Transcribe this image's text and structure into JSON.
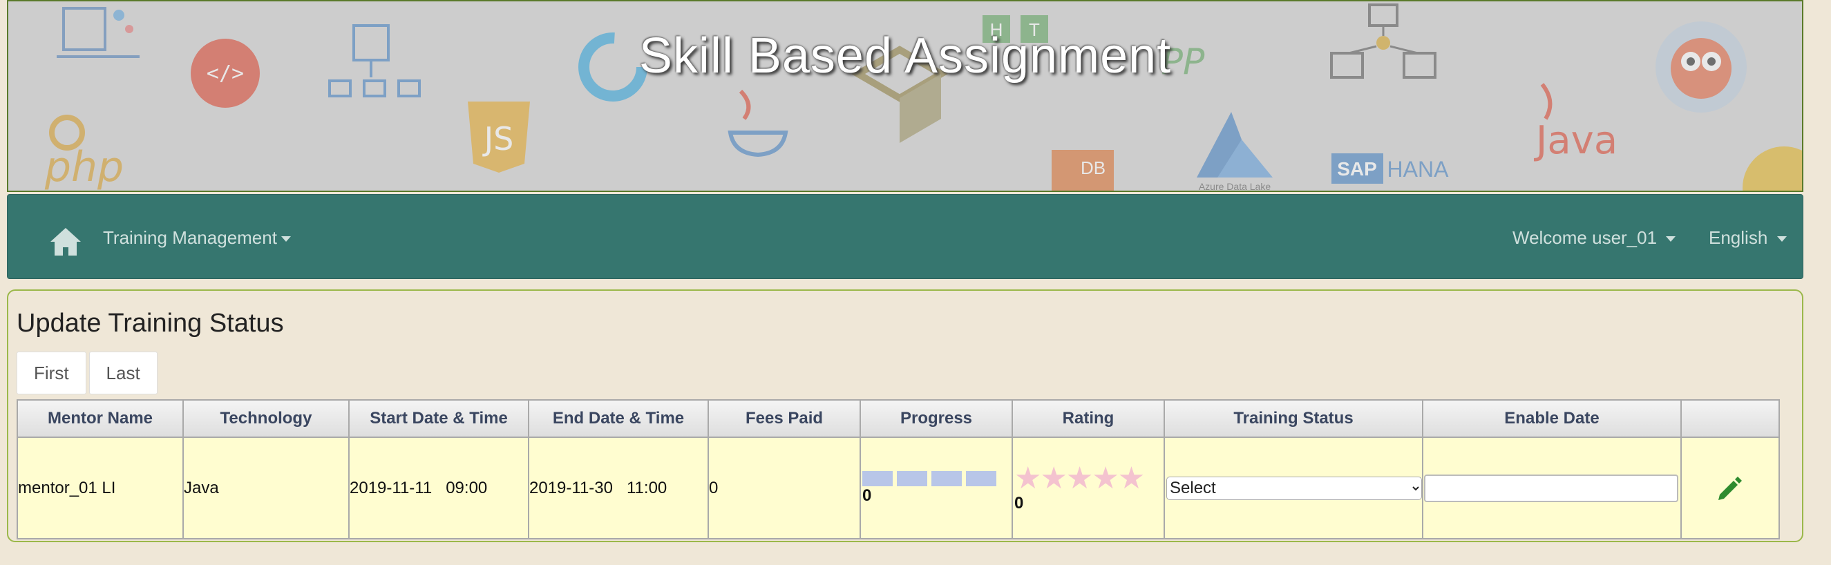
{
  "banner": {
    "title": "Skill Based Assignment"
  },
  "navbar": {
    "home_icon": "home-icon",
    "training_menu": "Training Management",
    "welcome": "Welcome user_01",
    "language": "English"
  },
  "panel": {
    "title": "Update Training Status",
    "pager": {
      "first": "First",
      "last": "Last"
    }
  },
  "table": {
    "headers": [
      "Mentor Name",
      "Technology",
      "Start Date & Time",
      "End Date & Time",
      "Fees Paid",
      "Progress",
      "Rating",
      "Training Status",
      "Enable Date",
      ""
    ],
    "rows": [
      {
        "mentor": "mentor_01 LI",
        "technology": "Java",
        "start": "2019-11-11   09:00",
        "end": "2019-11-30   11:00",
        "fees": "0",
        "progress_value": "0",
        "progress_fraction": 0,
        "rating_value": "0",
        "rating_stars": "★★★★★",
        "status_selected": "Select",
        "enable_date": "",
        "edit_icon": "pencil-icon"
      }
    ]
  },
  "colors": {
    "navbar": "#36766f",
    "row": "#fffdd0",
    "edit": "#2e8b2e"
  }
}
